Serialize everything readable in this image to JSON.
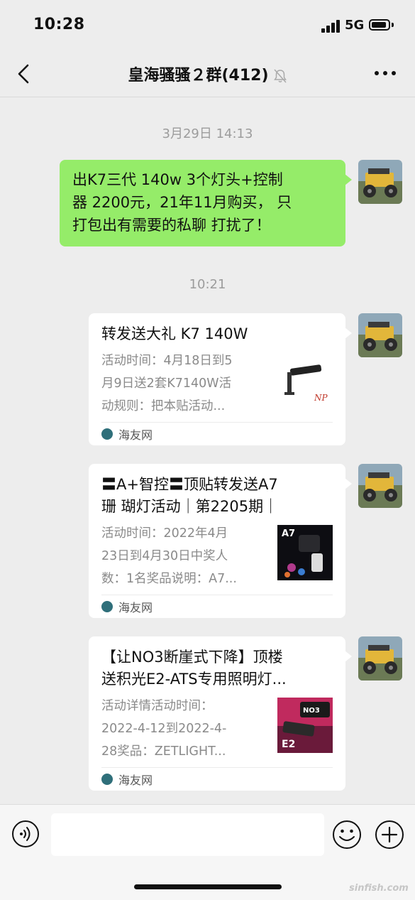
{
  "status_bar": {
    "time": "10:28",
    "network": "5G"
  },
  "header": {
    "title": "皇海骚骚２群(412)"
  },
  "messages": {
    "timestamp_1": "3月29日 14:13",
    "text_message": {
      "line_1": "出K7三代 140w 3个灯头+控制",
      "line_2": "器 2200元，21年11月购买， 只",
      "line_3": "打包出有需要的私聊 打扰了！"
    },
    "timestamp_2": "10:21",
    "cards": [
      {
        "title": "转发送大礼 K7 140W",
        "desc_1": "活动时间：4月18日到5",
        "desc_2": "月9日送2套K7140W活",
        "desc_3": "动规则：把本贴活动...",
        "source": "海友网",
        "thumb_label": "NP"
      },
      {
        "title_1": "〓A+智控〓顶贴转发送A7",
        "title_2": "珊 瑚灯活动｜第2205期｜",
        "desc_1": "活动时间：2022年4月",
        "desc_2": "23日到4月30日中奖人",
        "desc_3": "数：1名奖品说明：A7...",
        "source": "海友网",
        "thumb_label": "A7"
      },
      {
        "title_1": "【让NO3断崖式下降】顶楼",
        "title_2": "送积光E2-ATS专用照明灯...",
        "desc_1": "活动详情活动时间：",
        "desc_2": "2022-4-12到2022-4-",
        "desc_3": "28奖品：ZETLIGHT...",
        "source": "海友网",
        "thumb_label_1": "NO3",
        "thumb_label_2": "E2"
      }
    ]
  },
  "input": {
    "placeholder": ""
  },
  "watermark": "sinfish.com",
  "colors": {
    "bubble": "#95ec69",
    "background": "#ededed"
  }
}
